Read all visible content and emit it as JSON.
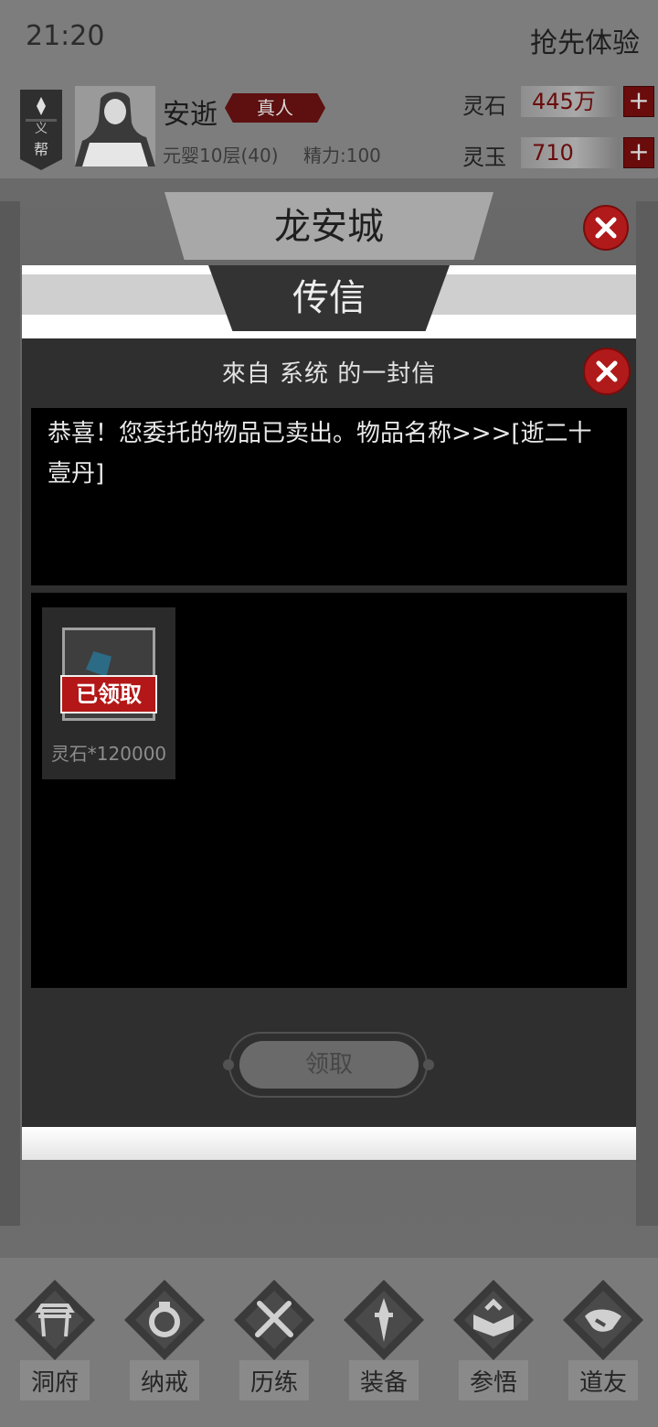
{
  "status_bar": {
    "time": "21:20",
    "right_text": "抢先体验"
  },
  "player": {
    "guild_banner_top": "义",
    "guild_banner_bottom": "帮",
    "name": "安逝",
    "tag": "真人",
    "level": "元婴10层(40)",
    "stamina": "精力:100"
  },
  "resources": [
    {
      "label": "灵石",
      "value": "445万"
    },
    {
      "label": "灵玉",
      "value": "710"
    }
  ],
  "scene": {
    "city_title": "龙安城"
  },
  "modal": {
    "title": "传信",
    "header": "來自  系统  的一封信",
    "message": "恭喜！您委托的物品已卖出。物品名称>>>[逝二十壹丹]",
    "attachments": [
      {
        "name": "灵石*120000",
        "stamp": "已领取"
      }
    ],
    "claim_button": "领取"
  },
  "nav": [
    {
      "label": "洞府",
      "icon": "cave-gate-icon"
    },
    {
      "label": "纳戒",
      "icon": "ring-icon"
    },
    {
      "label": "历练",
      "icon": "crossed-swords-icon"
    },
    {
      "label": "装备",
      "icon": "sword-equipment-icon"
    },
    {
      "label": "参悟",
      "icon": "open-book-icon"
    },
    {
      "label": "道友",
      "icon": "handshake-icon"
    }
  ],
  "colors": {
    "accent_red": "#b31717",
    "resource_value": "#6a0b0b"
  }
}
